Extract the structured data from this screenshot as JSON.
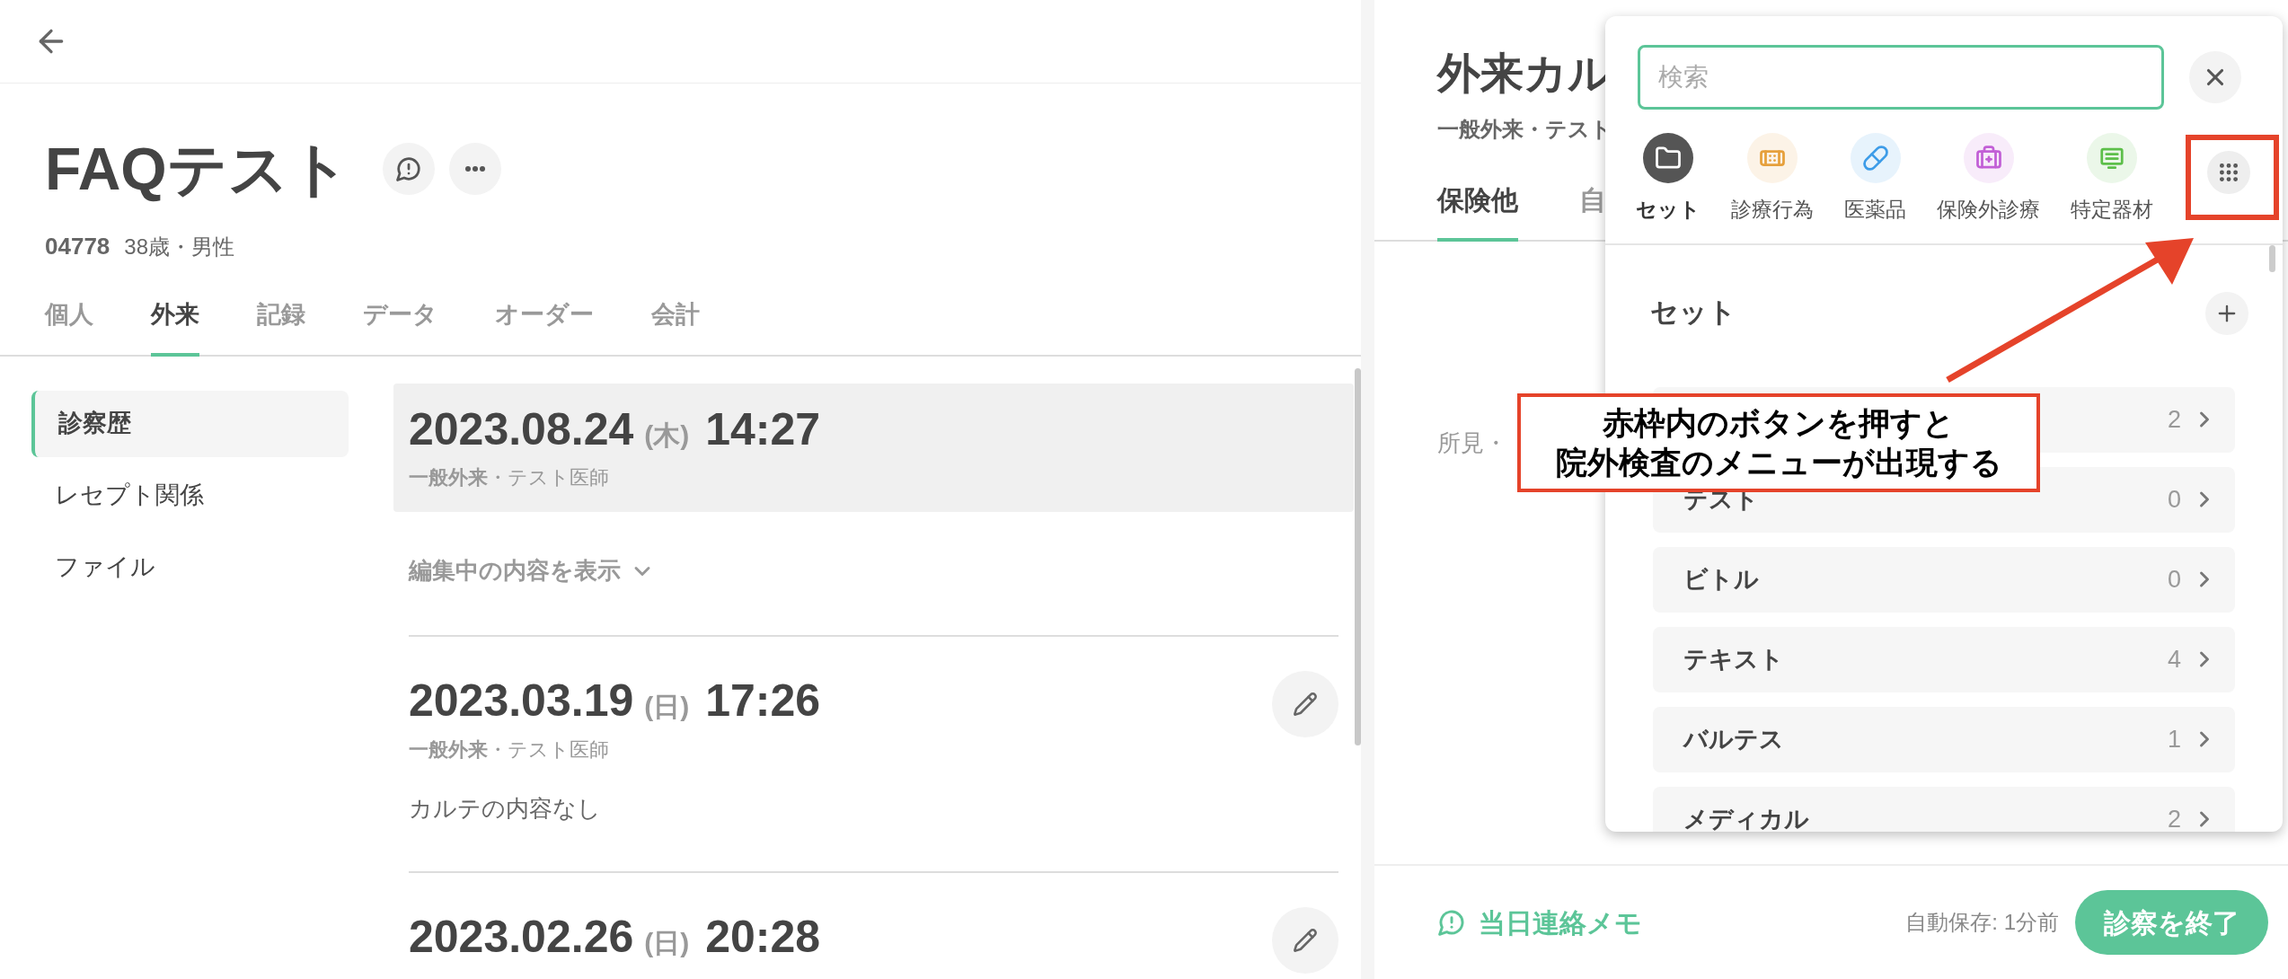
{
  "patient": {
    "name": "FAQテスト",
    "id": "04778",
    "info": "38歳・男性"
  },
  "tabs": [
    {
      "label": "個人",
      "selected": false
    },
    {
      "label": "外来",
      "selected": true
    },
    {
      "label": "記録",
      "selected": false
    },
    {
      "label": "データ",
      "selected": false
    },
    {
      "label": "オーダー",
      "selected": false
    },
    {
      "label": "会計",
      "selected": false
    }
  ],
  "sidebar": {
    "items": [
      {
        "label": "診察歴",
        "selected": true
      },
      {
        "label": "レセプト関係",
        "selected": false
      },
      {
        "label": "ファイル",
        "selected": false
      }
    ]
  },
  "visits": [
    {
      "date": "2023.08.24",
      "weekday": "(木)",
      "time": "14:27",
      "department": "一般外来",
      "doctor": "・テスト医師",
      "selected": true,
      "editable": false,
      "toggle": "編集中の内容を表示"
    },
    {
      "date": "2023.03.19",
      "weekday": "(日)",
      "time": "17:26",
      "department": "一般外来",
      "doctor": "・テスト医師",
      "selected": false,
      "editable": true,
      "note": "カルテの内容なし"
    },
    {
      "date": "2023.02.26",
      "weekday": "(日)",
      "time": "20:28",
      "selected": false,
      "editable": true
    }
  ],
  "chart_panel": {
    "title": "外来カル",
    "subtitle": "一般外来・テスト",
    "tabs": [
      {
        "label": "保険他",
        "selected": true
      },
      {
        "label": "自",
        "selected": false
      }
    ],
    "findings": "所見・"
  },
  "footer": {
    "memo": "当日連絡メモ",
    "autosave": "自動保存: 1分前",
    "finish": "診察を終了"
  },
  "picker": {
    "search_placeholder": "検索",
    "categories": [
      {
        "label": "セット",
        "selected": true,
        "color": "#555555"
      },
      {
        "label": "診療行為",
        "selected": false,
        "color": "#e6a03c"
      },
      {
        "label": "医薬品",
        "selected": false,
        "color": "#3d9ce8"
      },
      {
        "label": "保険外診療",
        "selected": false,
        "color": "#c25fd6"
      },
      {
        "label": "特定器材",
        "selected": false,
        "color": "#5dbf4a"
      }
    ],
    "section": "セット",
    "sets": [
      {
        "count": "2"
      },
      {
        "name": "テスト",
        "count": "0"
      },
      {
        "name": "ビトル",
        "count": "0"
      },
      {
        "name": "テキスト",
        "count": "4"
      },
      {
        "name": "バルテス",
        "count": "1"
      },
      {
        "name": "メディカル",
        "count": "2"
      }
    ]
  },
  "annotation": {
    "lines": [
      "赤枠内のボタンを押すと",
      "院外検査のメニューが出現する"
    ]
  }
}
